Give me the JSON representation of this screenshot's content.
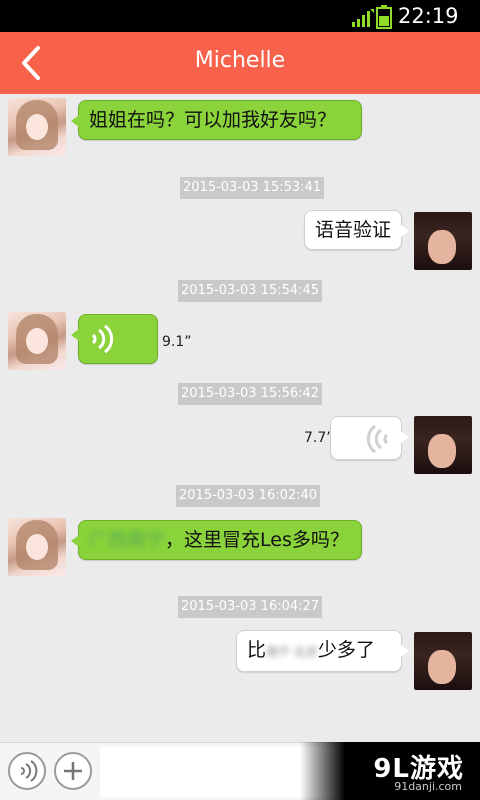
{
  "status_bar": {
    "time": "22:19"
  },
  "header": {
    "title": "Michelle"
  },
  "messages": [
    {
      "sender": "Michelle",
      "type": "text",
      "text": "姐姐在吗？可以加我好友吗？"
    },
    {
      "timestamp": "2015-03-03 15:53:41"
    },
    {
      "sender": "me",
      "type": "text",
      "text": "语音验证"
    },
    {
      "timestamp": "2015-03-03 15:54:45"
    },
    {
      "sender": "Michelle",
      "type": "voice",
      "duration": "9.1”"
    },
    {
      "timestamp": "2015-03-03 15:56:42"
    },
    {
      "sender": "me",
      "type": "voice",
      "duration": "7.7”"
    },
    {
      "timestamp": "2015-03-03 16:02:40"
    },
    {
      "sender": "Michelle",
      "type": "text",
      "text_blurred": "广西南宁",
      "text": "，这里冒充Les多吗？"
    },
    {
      "timestamp": "2015-03-03 16:04:27"
    },
    {
      "sender": "me",
      "type": "text",
      "text_before": "比",
      "text_blurred": "南宁 北京",
      "text_after": "少多了"
    }
  ],
  "input_bar": {
    "placeholder": ""
  },
  "watermark": {
    "logo": "9L游戏",
    "url": "91danji.com"
  }
}
